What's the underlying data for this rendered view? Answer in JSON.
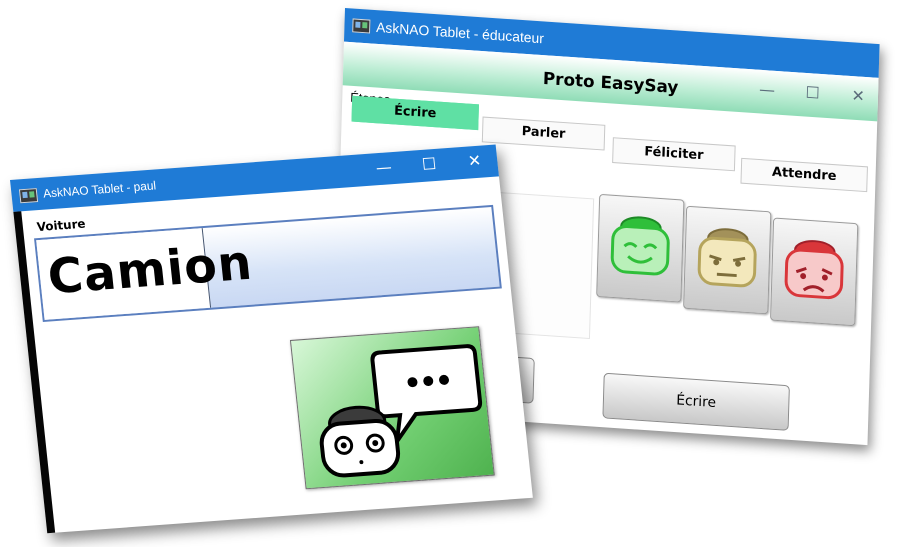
{
  "educator_window": {
    "title": "AskNAO Tablet - éducateur",
    "app_title": "Proto EasySay",
    "steps_label": "Étapes",
    "steps": [
      {
        "label": "Écrire",
        "active": true
      },
      {
        "label": "Parler",
        "active": false
      },
      {
        "label": "Féliciter",
        "active": false
      },
      {
        "label": "Attendre",
        "active": false
      }
    ],
    "faces": [
      {
        "mood": "happy",
        "color": "#2fbf3a"
      },
      {
        "mood": "neutral",
        "color": "#b5a45c"
      },
      {
        "mood": "sad",
        "color": "#d9363a"
      }
    ],
    "write_button_label": "Écrire",
    "accent_color": "#5fe0a4"
  },
  "child_window": {
    "title": "AskNAO Tablet - paul",
    "category_label": "Voiture",
    "word": "Camion",
    "speak_button_icon": "robot-speech-bubble-icon"
  },
  "titlebar_color": "#1f7bd6",
  "window_controls": {
    "minimize": "—",
    "maximize": "☐",
    "close": "✕"
  }
}
